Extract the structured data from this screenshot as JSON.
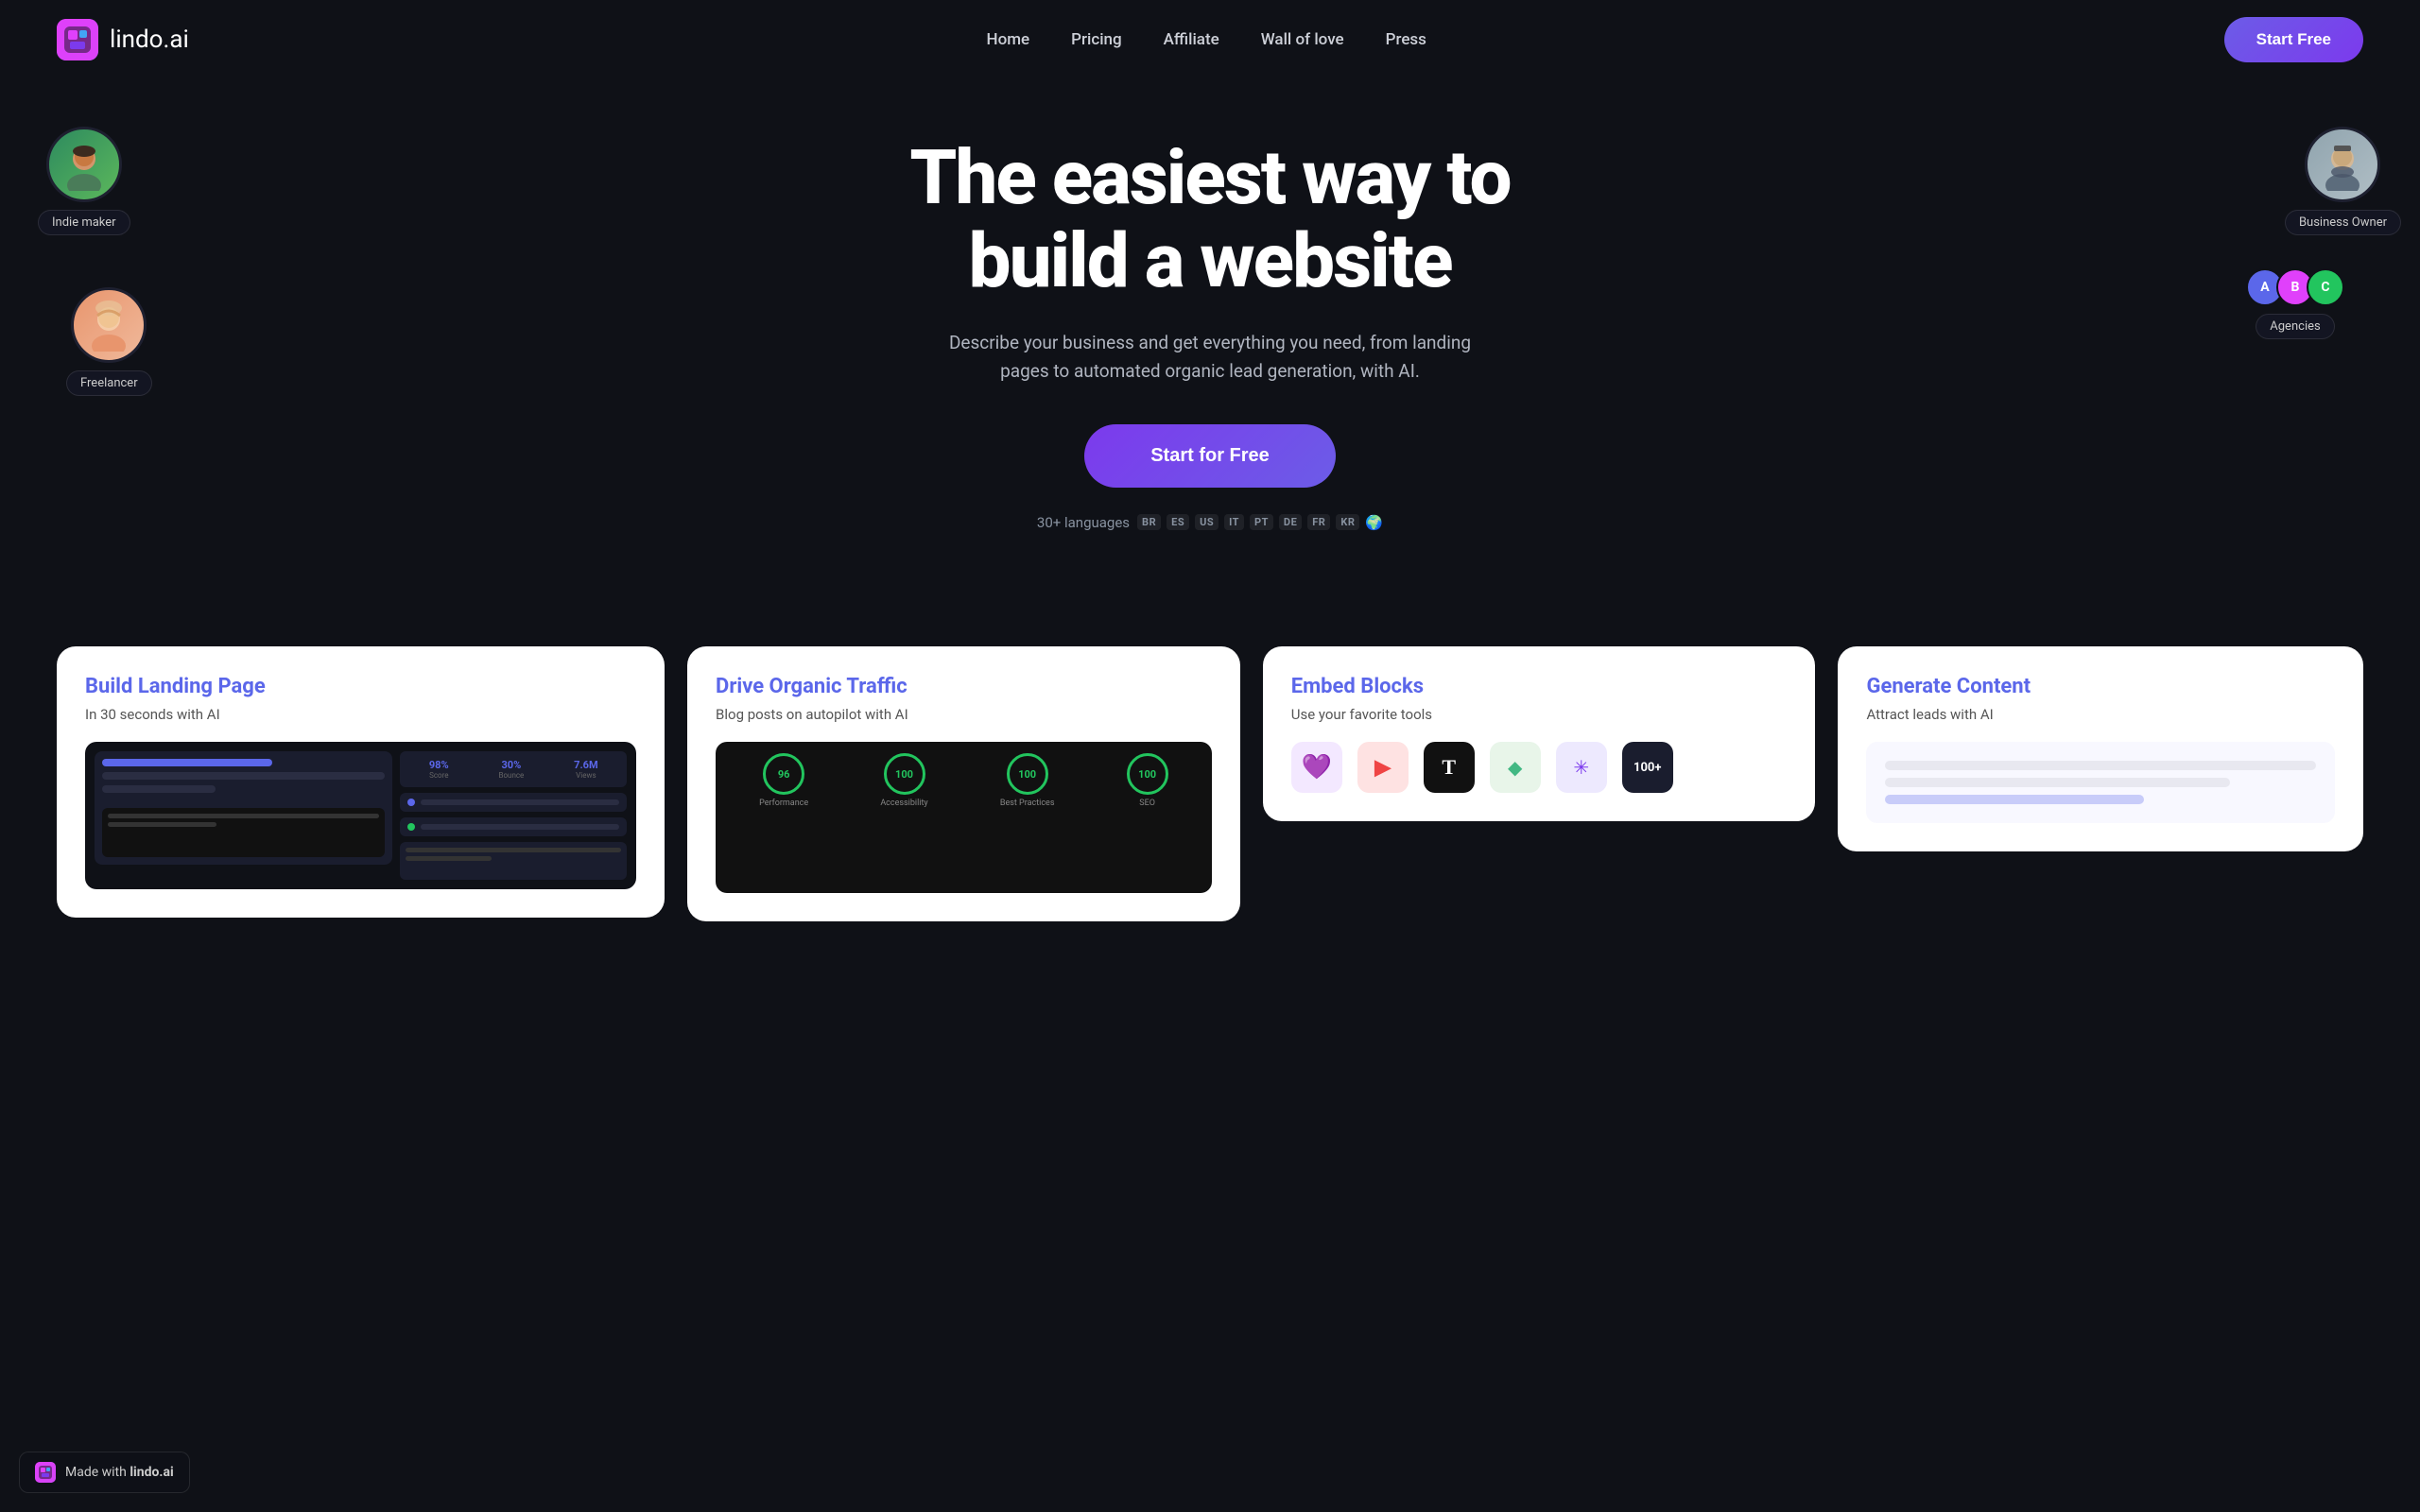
{
  "navbar": {
    "logo_text": "lindo",
    "logo_suffix": ".ai",
    "nav_items": [
      {
        "label": "Home",
        "href": "#"
      },
      {
        "label": "Pricing",
        "href": "#"
      },
      {
        "label": "Affiliate",
        "href": "#"
      },
      {
        "label": "Wall of love",
        "href": "#"
      },
      {
        "label": "Press",
        "href": "#"
      }
    ],
    "cta_label": "Start Free"
  },
  "hero": {
    "title_line1": "The easiest way to",
    "title_line2": "build a website",
    "subtitle": "Describe your business and get everything you need, from landing pages to automated organic lead generation, with AI.",
    "cta_label": "Start for Free",
    "languages_prefix": "30+ languages",
    "language_badges": [
      "BR",
      "ES",
      "US",
      "IT",
      "PT",
      "DE",
      "FR",
      "KR"
    ],
    "globe_emoji": "🌍"
  },
  "avatars": {
    "indie_maker": {
      "label": "Indie maker",
      "emoji": "👨",
      "bg": "#3d9970"
    },
    "freelancer": {
      "label": "Freelancer",
      "emoji": "👩",
      "bg": "#e8956d"
    },
    "business_owner": {
      "label": "Business Owner",
      "emoji": "👨‍💼",
      "bg": "#b0bec5"
    },
    "agencies": {
      "label": "Agencies",
      "avatars": [
        "A",
        "B",
        "C"
      ]
    }
  },
  "cards": [
    {
      "id": "build-landing",
      "title": "Build Landing Page",
      "subtitle": "In 30 seconds with AI",
      "type": "landing"
    },
    {
      "id": "drive-traffic",
      "title": "Drive Organic Traffic",
      "subtitle": "Blog posts on autopilot with AI",
      "type": "traffic"
    },
    {
      "id": "embed-blocks",
      "title": "Embed Blocks",
      "subtitle": "Use your favorite tools",
      "type": "embed"
    },
    {
      "id": "generate-content",
      "title": "Generate Content",
      "subtitle": "Attract leads with AI",
      "type": "generate"
    }
  ],
  "scores": [
    {
      "value": "96",
      "label": "Performance",
      "color": "#22c55e"
    },
    {
      "value": "100",
      "label": "Accessibility",
      "color": "#22c55e"
    },
    {
      "value": "100",
      "label": "Best Practices",
      "color": "#22c55e"
    },
    {
      "value": "100",
      "label": "SEO",
      "color": "#22c55e"
    }
  ],
  "embed_icons": [
    {
      "name": "heart-icon",
      "symbol": "💜",
      "bg": "#f3e8ff"
    },
    {
      "name": "youtube-icon",
      "symbol": "▶",
      "bg": "#fee2e2",
      "color": "#ef4444"
    },
    {
      "name": "typeform-icon",
      "symbol": "T",
      "bg": "#111",
      "color": "#fff"
    },
    {
      "name": "vue-icon",
      "symbol": "◆",
      "bg": "#e8f5e9",
      "color": "#42b883"
    },
    {
      "name": "asterisk-icon",
      "symbol": "✳",
      "bg": "#ede9fe",
      "color": "#7c3aed"
    },
    {
      "name": "more-icon",
      "label": "100+",
      "bg": "#1a1d2e",
      "color": "#fff"
    }
  ],
  "footer_badge": {
    "prefix": "Made with",
    "brand": "lindo.ai"
  }
}
